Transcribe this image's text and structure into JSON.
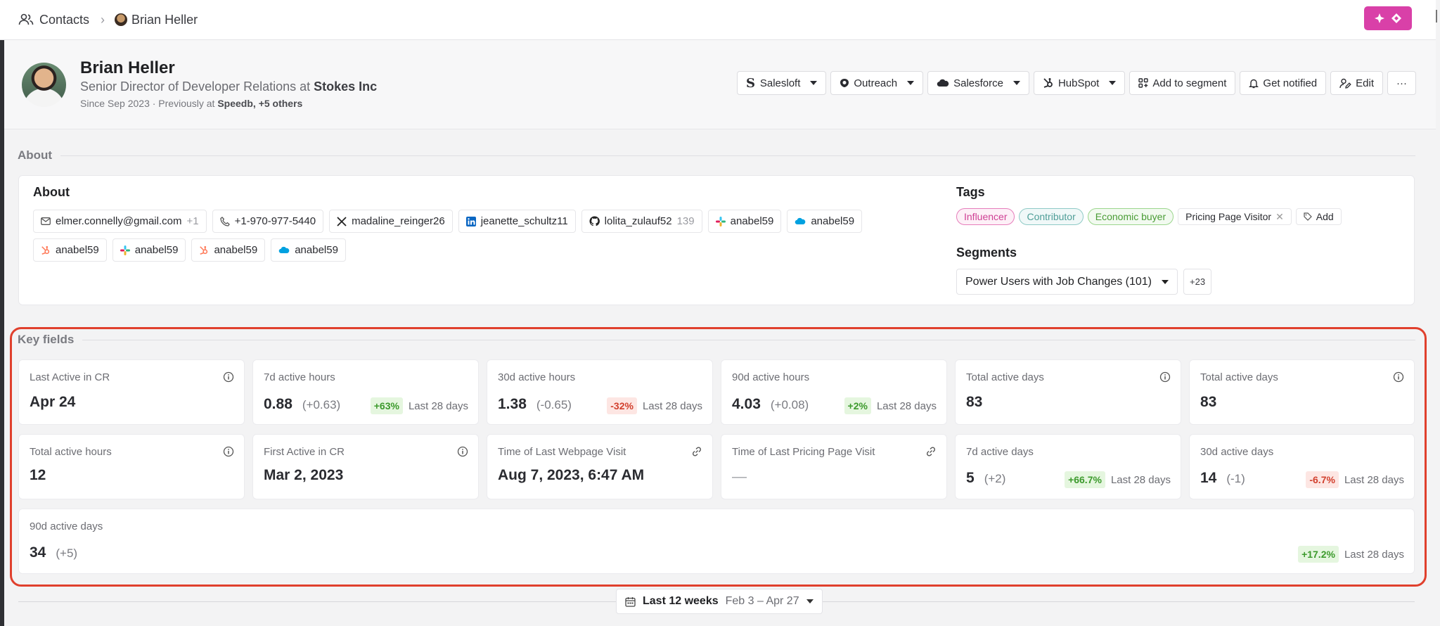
{
  "breadcrumb": {
    "root": "Contacts",
    "current": "Brian Heller"
  },
  "profile": {
    "name": "Brian Heller",
    "role": "Senior Director of Developer Relations at ",
    "company": "Stokes Inc",
    "since_prefix": "Since Sep 2023 · Previously at ",
    "previous": "Speedb, +5 others"
  },
  "actions": {
    "salesloft": "Salesloft",
    "outreach": "Outreach",
    "salesforce": "Salesforce",
    "hubspot": "HubSpot",
    "add_segment": "Add to segment",
    "notify": "Get notified",
    "edit": "Edit",
    "more": "···"
  },
  "about": {
    "section_title": "About",
    "card_title": "About",
    "email": "elmer.connelly@gmail.com",
    "email_extra": "+1",
    "phone": "+1-970-977-5440",
    "x": "madaline_reinger26",
    "linkedin": "jeanette_schultz11",
    "github": "lolita_zulauf52",
    "github_count": "139",
    "slack1": "anabel59",
    "sf1": "anabel59",
    "hub1": "anabel59",
    "slack2": "anabel59",
    "hub2": "anabel59",
    "sf2": "anabel59"
  },
  "tags": {
    "title": "Tags",
    "items": [
      "Influencer",
      "Contributor",
      "Economic buyer",
      "Pricing Page Visitor"
    ],
    "add": "Add"
  },
  "segments": {
    "title": "Segments",
    "selected": "Power Users with Job Changes (101)",
    "more": "+23"
  },
  "key_fields": {
    "title": "Key fields",
    "cards": [
      {
        "label": "Last Active in CR",
        "value": "Apr 24"
      },
      {
        "label": "7d active hours",
        "value": "0.88",
        "delta": "(+0.63)",
        "badge": "+63%",
        "period": "Last 28 days"
      },
      {
        "label": "30d active hours",
        "value": "1.38",
        "delta": "(-0.65)",
        "badge": "-32%",
        "period": "Last 28 days"
      },
      {
        "label": "90d active hours",
        "value": "4.03",
        "delta": "(+0.08)",
        "badge": "+2%",
        "period": "Last 28 days"
      },
      {
        "label": "Total active days",
        "value": "83"
      },
      {
        "label": "Total active days",
        "value": "83"
      },
      {
        "label": "Total active hours",
        "value": "12"
      },
      {
        "label": "First Active in CR",
        "value": "Mar 2, 2023"
      },
      {
        "label": "Time of Last Webpage Visit",
        "value": "Aug 7, 2023, 6:47 AM"
      },
      {
        "label": "Time of Last Pricing Page Visit",
        "value": "—"
      },
      {
        "label": "7d active days",
        "value": "5",
        "delta": "(+2)",
        "badge": "+66.7%",
        "period": "Last 28 days"
      },
      {
        "label": "30d active days",
        "value": "14",
        "delta": "(-1)",
        "badge": "-6.7%",
        "period": "Last 28 days"
      },
      {
        "label": "90d active days",
        "value": "34",
        "delta": "(+5)",
        "badge": "+17.2%",
        "period": "Last 28 days"
      }
    ]
  },
  "range": {
    "label": "Last 12 weeks",
    "dates": "Feb 3 – Apr 27"
  },
  "colors": {
    "brand": "#d940a8",
    "highlight": "#e0402d",
    "up": "#3c9a2c",
    "down": "#d2402e"
  }
}
